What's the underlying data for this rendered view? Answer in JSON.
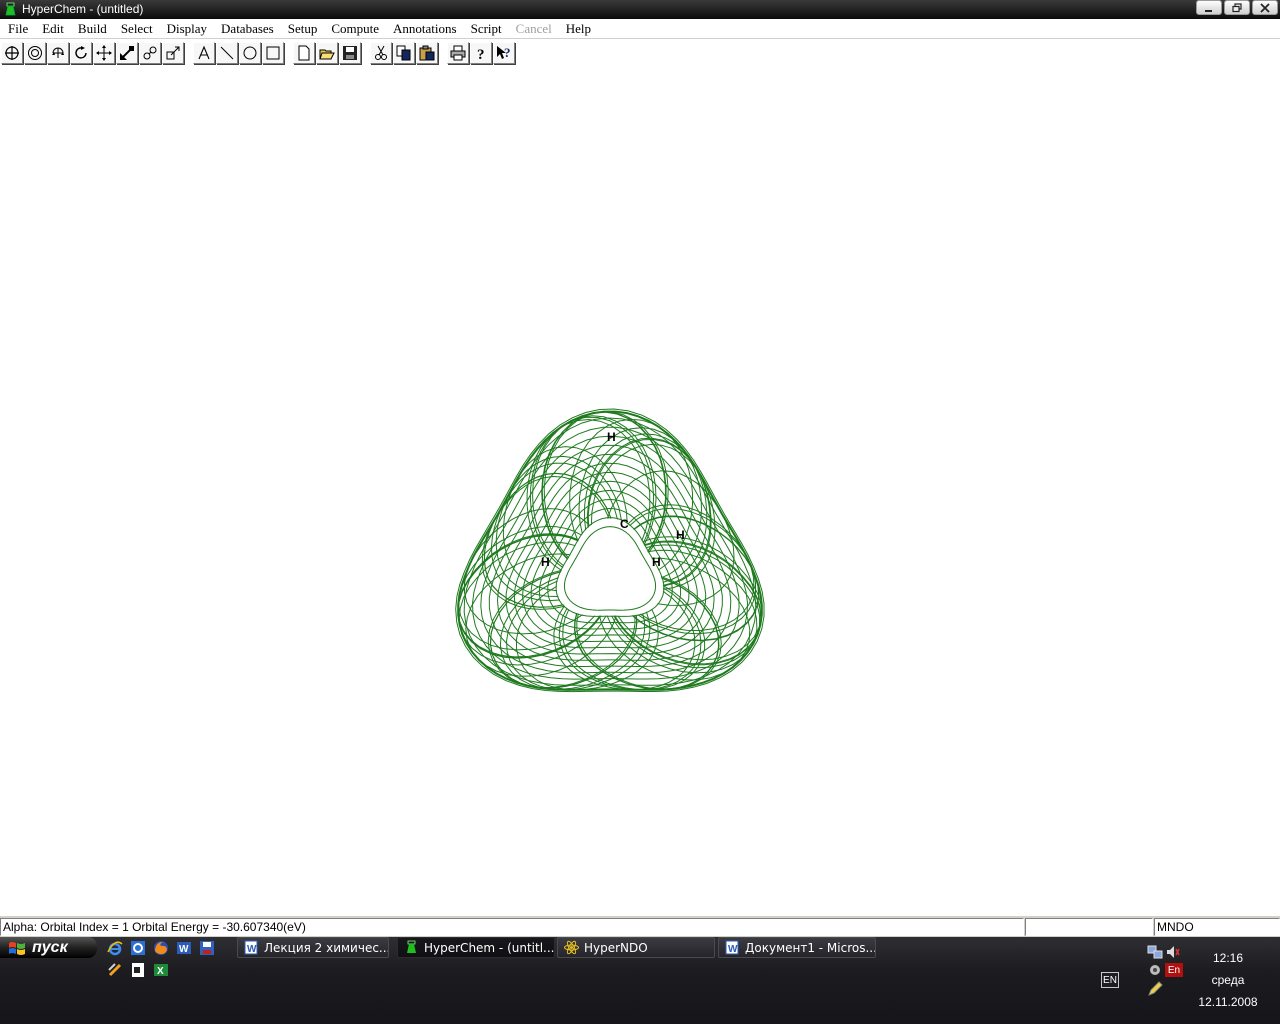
{
  "window": {
    "title": "HyperChem - (untitled)",
    "icon": "hyperchem-flask-icon"
  },
  "menu": [
    {
      "label": "File",
      "enabled": true
    },
    {
      "label": "Edit",
      "enabled": true
    },
    {
      "label": "Build",
      "enabled": true
    },
    {
      "label": "Select",
      "enabled": true
    },
    {
      "label": "Display",
      "enabled": true
    },
    {
      "label": "Databases",
      "enabled": true
    },
    {
      "label": "Setup",
      "enabled": true
    },
    {
      "label": "Compute",
      "enabled": true
    },
    {
      "label": "Annotations",
      "enabled": true
    },
    {
      "label": "Script",
      "enabled": true
    },
    {
      "label": "Cancel",
      "enabled": false
    },
    {
      "label": "Help",
      "enabled": true
    }
  ],
  "toolbar": {
    "tools": [
      "draw-tool-icon",
      "select-tool-icon",
      "rotate-xy-icon",
      "rotate-z-icon",
      "translate-xy-icon",
      "translate-z-icon",
      "zoom-icon",
      "z-clip-icon",
      "text-tool-icon",
      "line-tool-icon",
      "ellipse-tool-icon",
      "rectangle-tool-icon",
      "new-file-icon",
      "open-file-icon",
      "save-file-icon",
      "cut-icon",
      "copy-icon",
      "paste-icon",
      "print-icon",
      "help-icon",
      "context-help-icon"
    ]
  },
  "molecule": {
    "surface_color": "#1f7a1f",
    "atoms": [
      {
        "label": "H"
      },
      {
        "label": "C"
      },
      {
        "label": "H"
      },
      {
        "label": "H"
      },
      {
        "label": "H"
      }
    ]
  },
  "status": {
    "message": "Alpha: Orbital Index = 1 Orbital Energy = -30.607340(eV)",
    "middle": "",
    "method": "MNDO"
  },
  "taskbar": {
    "start_label": "пуск",
    "quick_launch": [
      "internet-explorer-icon",
      "ie-alt-icon",
      "firefox-icon",
      "word-icon",
      "save-disk-icon",
      "tool-icon",
      "document-icon",
      "excel-icon"
    ],
    "tasks": [
      {
        "label": "Лекция 2 химичес...",
        "icon": "word-doc-icon",
        "active": false
      },
      {
        "label": "HyperChem - (untitl...",
        "icon": "hyperchem-flask-icon",
        "active": true
      },
      {
        "label": "HyperNDO",
        "icon": "hyperndo-atom-icon",
        "active": false
      },
      {
        "label": "Документ1 - Micros...",
        "icon": "word-doc-icon",
        "active": false
      }
    ],
    "language": "EN",
    "tray_language": "En",
    "clock": {
      "time": "12:16",
      "day": "среда",
      "date": "12.11.2008"
    }
  }
}
